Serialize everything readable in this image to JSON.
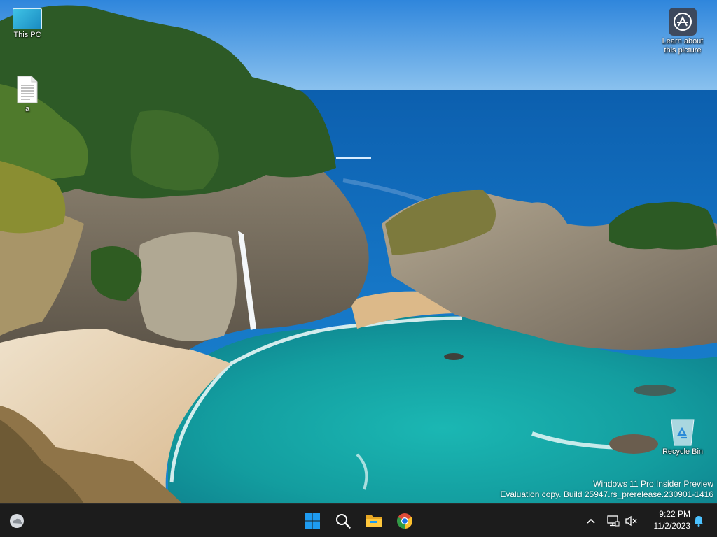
{
  "desktop": {
    "icons": [
      {
        "label": "This PC",
        "icon": "this-pc-icon"
      },
      {
        "label": "a",
        "icon": "text-file-icon"
      },
      {
        "label": "Learn about\nthis picture",
        "icon": "camera-icon"
      },
      {
        "label": "Recycle Bin",
        "icon": "recycle-bin-icon"
      }
    ]
  },
  "watermark": {
    "line1": "Windows 11 Pro Insider Preview",
    "line2": "Evaluation copy. Build 25947.rs_prerelease.230901-1416"
  },
  "taskbar": {
    "apps": [
      {
        "name": "Widgets",
        "icon": "weather-widget-icon"
      },
      {
        "name": "Start",
        "icon": "windows-start-icon"
      },
      {
        "name": "Search",
        "icon": "search-icon"
      },
      {
        "name": "File Explorer",
        "icon": "folder-icon"
      },
      {
        "name": "Google Chrome",
        "icon": "chrome-icon"
      }
    ],
    "tray": {
      "time": "9:22 PM",
      "date": "11/2/2023"
    },
    "background": "#1c1c1c",
    "start_accent": "#1e9bf0"
  }
}
